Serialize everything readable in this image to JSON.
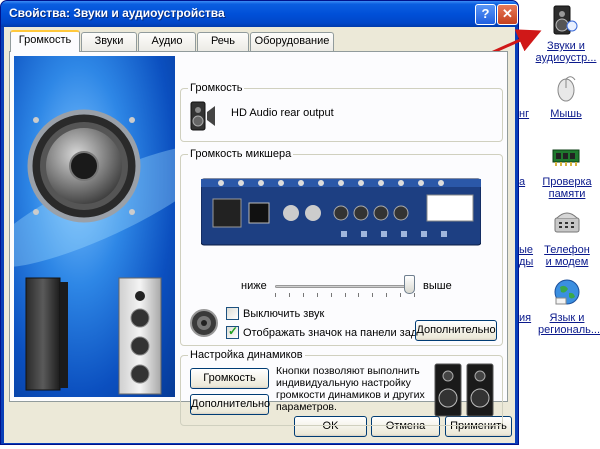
{
  "window": {
    "title": "Свойства: Звуки и аудиоустройства",
    "help_glyph": "?",
    "close_glyph": "✕"
  },
  "tabs": [
    {
      "label": "Громкость",
      "active": true
    },
    {
      "label": "Звуки",
      "active": false
    },
    {
      "label": "Аудио",
      "active": false
    },
    {
      "label": "Речь",
      "active": false
    },
    {
      "label": "Оборудование",
      "active": false
    }
  ],
  "volume_group": {
    "label": "Громкость",
    "device_name": "HD Audio rear output"
  },
  "mixer_group": {
    "label": "Громкость микшера",
    "slider_min_label": "ниже",
    "slider_max_label": "выше",
    "slider_level": 1.0,
    "mute_label": "Выключить звук",
    "mute_checked": false,
    "tray_icon_label": "Отображать значок на панели задач",
    "tray_icon_checked": true,
    "advanced_button": "Дополнительно"
  },
  "speakers_group": {
    "label": "Настройка динамиков",
    "volume_button": "Громкость",
    "advanced_button": "Дополнительно",
    "description": "Кнопки позволяют выполнить индивидуальную настройку громкости динамиков и других параметров."
  },
  "footer": {
    "ok": "OK",
    "cancel": "Отмена",
    "apply": "Применить"
  },
  "desktop_icons": [
    {
      "label": "Звуки и аудиоустр...",
      "icon": "sound-speaker-icon"
    },
    {
      "label": "Мышь",
      "icon": "mouse-icon"
    },
    {
      "label": "Проверка памяти",
      "icon": "memory-chip-icon"
    },
    {
      "label": "Телефон и модем",
      "icon": "phone-modem-icon"
    },
    {
      "label": "Язык и региональ...",
      "icon": "globe-language-icon"
    }
  ],
  "desktop_cut_labels": [
    "нг",
    "а",
    "ые",
    "ды",
    "ия"
  ],
  "colors": {
    "arrow": "#d01818",
    "title_bar": "#0050d8",
    "tab_highlight": "#ffc83c"
  }
}
